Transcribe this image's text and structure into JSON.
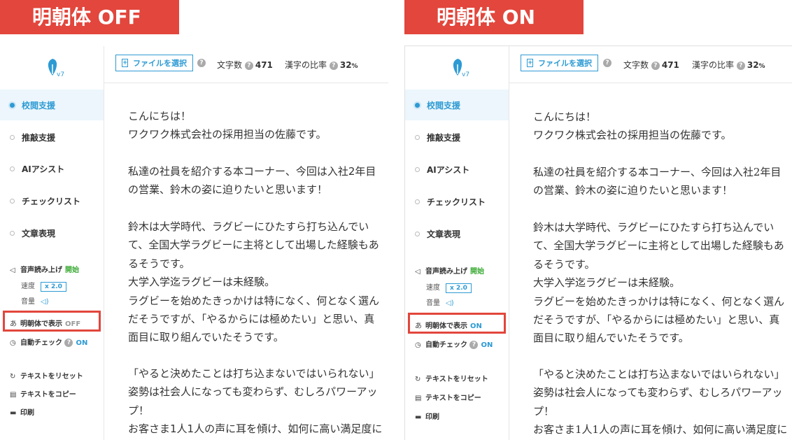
{
  "left": {
    "banner": "明朝体 OFF",
    "logo_version": "v7",
    "nav": [
      "校閲支援",
      "推敲支援",
      "AIアシスト",
      "チェックリスト",
      "文章表現"
    ],
    "tts": {
      "label": "音声読み上げ",
      "start": "開始",
      "speed_label": "速度",
      "speed_value": "x 2.0",
      "volume_label": "音量"
    },
    "mincho": {
      "label": "明朝体で表示",
      "state": "OFF"
    },
    "autocheck": {
      "label": "自動チェック",
      "state": "ON"
    },
    "reset": "テキストをリセット",
    "copy": "テキストをコピー",
    "print": "印刷",
    "file_button": "ファイルを選択",
    "char_count_label": "文字数",
    "char_count": "471",
    "kanji_label": "漢字の比率",
    "kanji_value": "32",
    "kanji_unit": "%",
    "paragraphs": [
      "こんにちは！\nワクワク株式会社の採用担当の佐藤です。",
      "私達の社員を紹介する本コーナー、今回は入社2年目\nの営業、鈴木の姿に迫りたいと思います！",
      "鈴木は大学時代、ラグビーにひたすら打ち込んでい\nて、全国大学ラグビーに主将として出場した経験もあ\nるそうです。\n大学入学迄ラグビーは未経験。\nラグビーを始めたきっかけは特になく、何となく選ん\nだそうですが、「やるからには極めたい」と思い、真\n面目に取り組んでいたそうです。",
      "「やると決めたことは打ち込まないではいられない」\n姿勢は社会人になっても変わらず、むしろパワーアッ\nプ！\nお客さま1人1人の声に耳を傾け、如何に高い満足度に"
    ]
  },
  "right": {
    "banner": "明朝体 ON",
    "logo_version": "v7",
    "nav": [
      "校閲支援",
      "推敲支援",
      "AIアシスト",
      "チェックリスト",
      "文章表現"
    ],
    "tts": {
      "label": "音声読み上げ",
      "start": "開始",
      "speed_label": "速度",
      "speed_value": "x 2.0",
      "volume_label": "音量"
    },
    "mincho": {
      "label": "明朝体で表示",
      "state": "ON"
    },
    "autocheck": {
      "label": "自動チェック",
      "state": "ON"
    },
    "reset": "テキストをリセット",
    "copy": "テキストをコピー",
    "print": "印刷",
    "file_button": "ファイルを選択",
    "char_count_label": "文字数",
    "char_count": "471",
    "kanji_label": "漢字の比率",
    "kanji_value": "32",
    "kanji_unit": "%",
    "paragraphs": [
      "こんにちは！\nワクワク株式会社の採用担当の佐藤です。",
      "私達の社員を紹介する本コーナー、今回は入社2年目\nの営業、鈴木の姿に迫りたいと思います！",
      "鈴木は大学時代、ラグビーにひたすら打ち込んでい\nて、全国大学ラグビーに主将として出場した経験もあ\nるそうです。\n大学入学迄ラグビーは未経験。\nラグビーを始めたきっかけは特になく、何となく選ん\nだそうですが、「やるからには極めたい」と思い、真\n面目に取り組んでいたそうです。",
      "「やると決めたことは打ち込まないではいられない」\n姿勢は社会人になっても変わらず、むしろパワーアッ\nプ！\nお客さま1人1人の声に耳を傾け、如何に高い満足度に"
    ]
  },
  "colors": {
    "banner": "#e2463c",
    "accent": "#2d9ad3",
    "green": "#3aaa35"
  },
  "icons": [
    "pen-logo-icon",
    "speaker-icon",
    "volume-icon",
    "hiragana-a-icon",
    "timer-icon",
    "reset-icon",
    "copy-icon",
    "print-icon",
    "file-add-icon",
    "help-icon"
  ]
}
